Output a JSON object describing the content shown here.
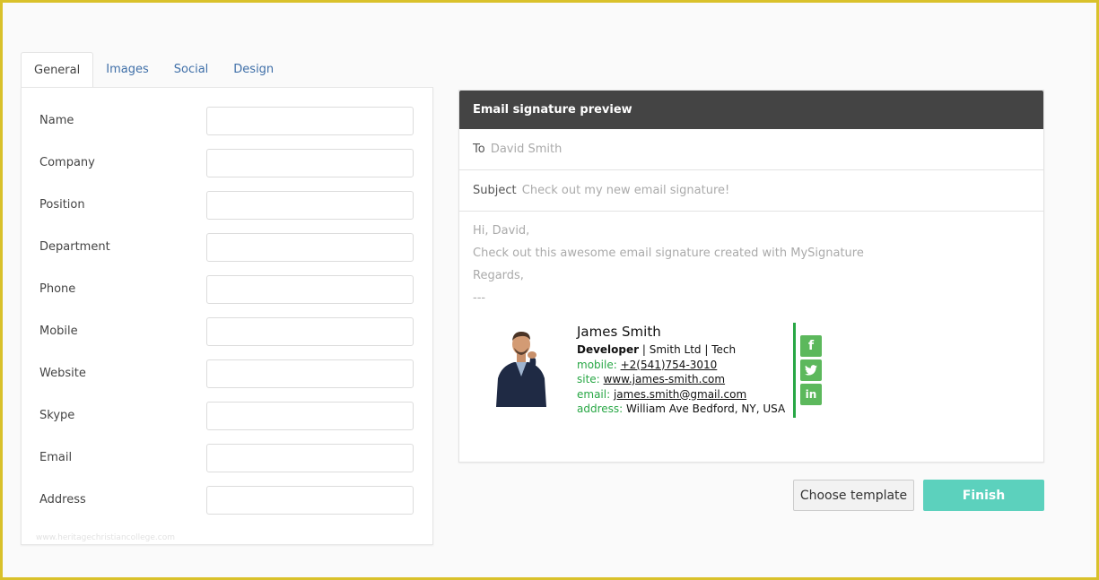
{
  "tabs": [
    {
      "label": "General",
      "active": true
    },
    {
      "label": "Images",
      "active": false
    },
    {
      "label": "Social",
      "active": false
    },
    {
      "label": "Design",
      "active": false
    }
  ],
  "form": {
    "fields": [
      {
        "label": "Name",
        "value": ""
      },
      {
        "label": "Company",
        "value": ""
      },
      {
        "label": "Position",
        "value": ""
      },
      {
        "label": "Department",
        "value": ""
      },
      {
        "label": "Phone",
        "value": ""
      },
      {
        "label": "Mobile",
        "value": ""
      },
      {
        "label": "Website",
        "value": ""
      },
      {
        "label": "Skype",
        "value": ""
      },
      {
        "label": "Email",
        "value": ""
      },
      {
        "label": "Address",
        "value": ""
      }
    ],
    "watermark": "www.heritagechristiancollege.com"
  },
  "preview": {
    "title": "Email signature preview",
    "to_label": "To",
    "to_value": "David Smith",
    "subject_label": "Subject",
    "subject_value": "Check out my new email signature!",
    "body_lines": [
      "Hi, David,",
      "Check out this awesome email signature created with MySignature",
      "Regards,",
      "---"
    ]
  },
  "signature": {
    "name": "James Smith",
    "position": "Developer",
    "company_line": " | Smith Ltd | Tech",
    "mobile_label": "mobile:",
    "mobile": "+2(541)754-3010",
    "site_label": "site:",
    "site": "www.james-smith.com",
    "email_label": "email:",
    "email": "james.smith@gmail.com",
    "address_label": "address:",
    "address": "William Ave Bedford, NY, USA",
    "accent_color": "#28a745",
    "social": [
      {
        "icon": "facebook-icon",
        "glyph": "f"
      },
      {
        "icon": "twitter-icon",
        "glyph": "t"
      },
      {
        "icon": "linkedin-icon",
        "glyph": "in"
      }
    ]
  },
  "buttons": {
    "choose_template": "Choose template",
    "finish": "Finish"
  },
  "colors": {
    "finish_button": "#5cd1bd",
    "header_bg": "#444444",
    "tab_link": "#3f6fa8"
  }
}
